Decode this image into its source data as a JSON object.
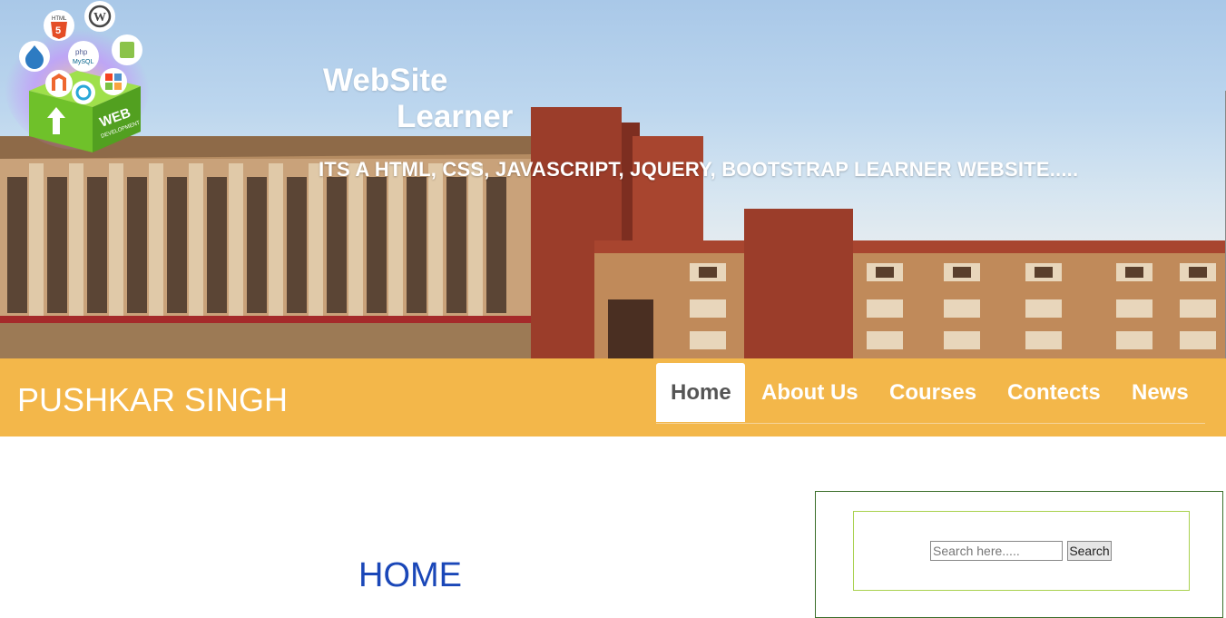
{
  "banner": {
    "title_line1": "WebSite",
    "title_line2": "Learner",
    "tagline": "ITS A HTML, CSS, JAVASCRIPT, JQUERY, BOOTSTRAP LEARNER WEBSITE.....",
    "logo": {
      "box_text": "WEB",
      "box_subtext": "DEVELOPMENT",
      "badges": [
        "html5-icon",
        "wordpress-icon",
        "drupal-icon",
        "php-mysql-icon",
        "opencart-icon",
        "magento-icon",
        "joomla-icon",
        "spiral-icon"
      ],
      "html5_text": "HTML",
      "html5_number": "5",
      "wordpress_letter": "W",
      "php_text": "php",
      "mysql_text": "MySQL"
    }
  },
  "navbar": {
    "brand": "PUSHKAR SINGH",
    "items": [
      {
        "label": "Home",
        "active": true
      },
      {
        "label": "About Us",
        "active": false
      },
      {
        "label": "Courses",
        "active": false
      },
      {
        "label": "Contects",
        "active": false
      },
      {
        "label": "News",
        "active": false
      }
    ],
    "background_color": "#f3b74a"
  },
  "main": {
    "heading": "HOME",
    "heading_color": "#1a47b8"
  },
  "sidebar": {
    "search": {
      "placeholder": "Search here.....",
      "value": "",
      "button_label": "Search"
    }
  }
}
